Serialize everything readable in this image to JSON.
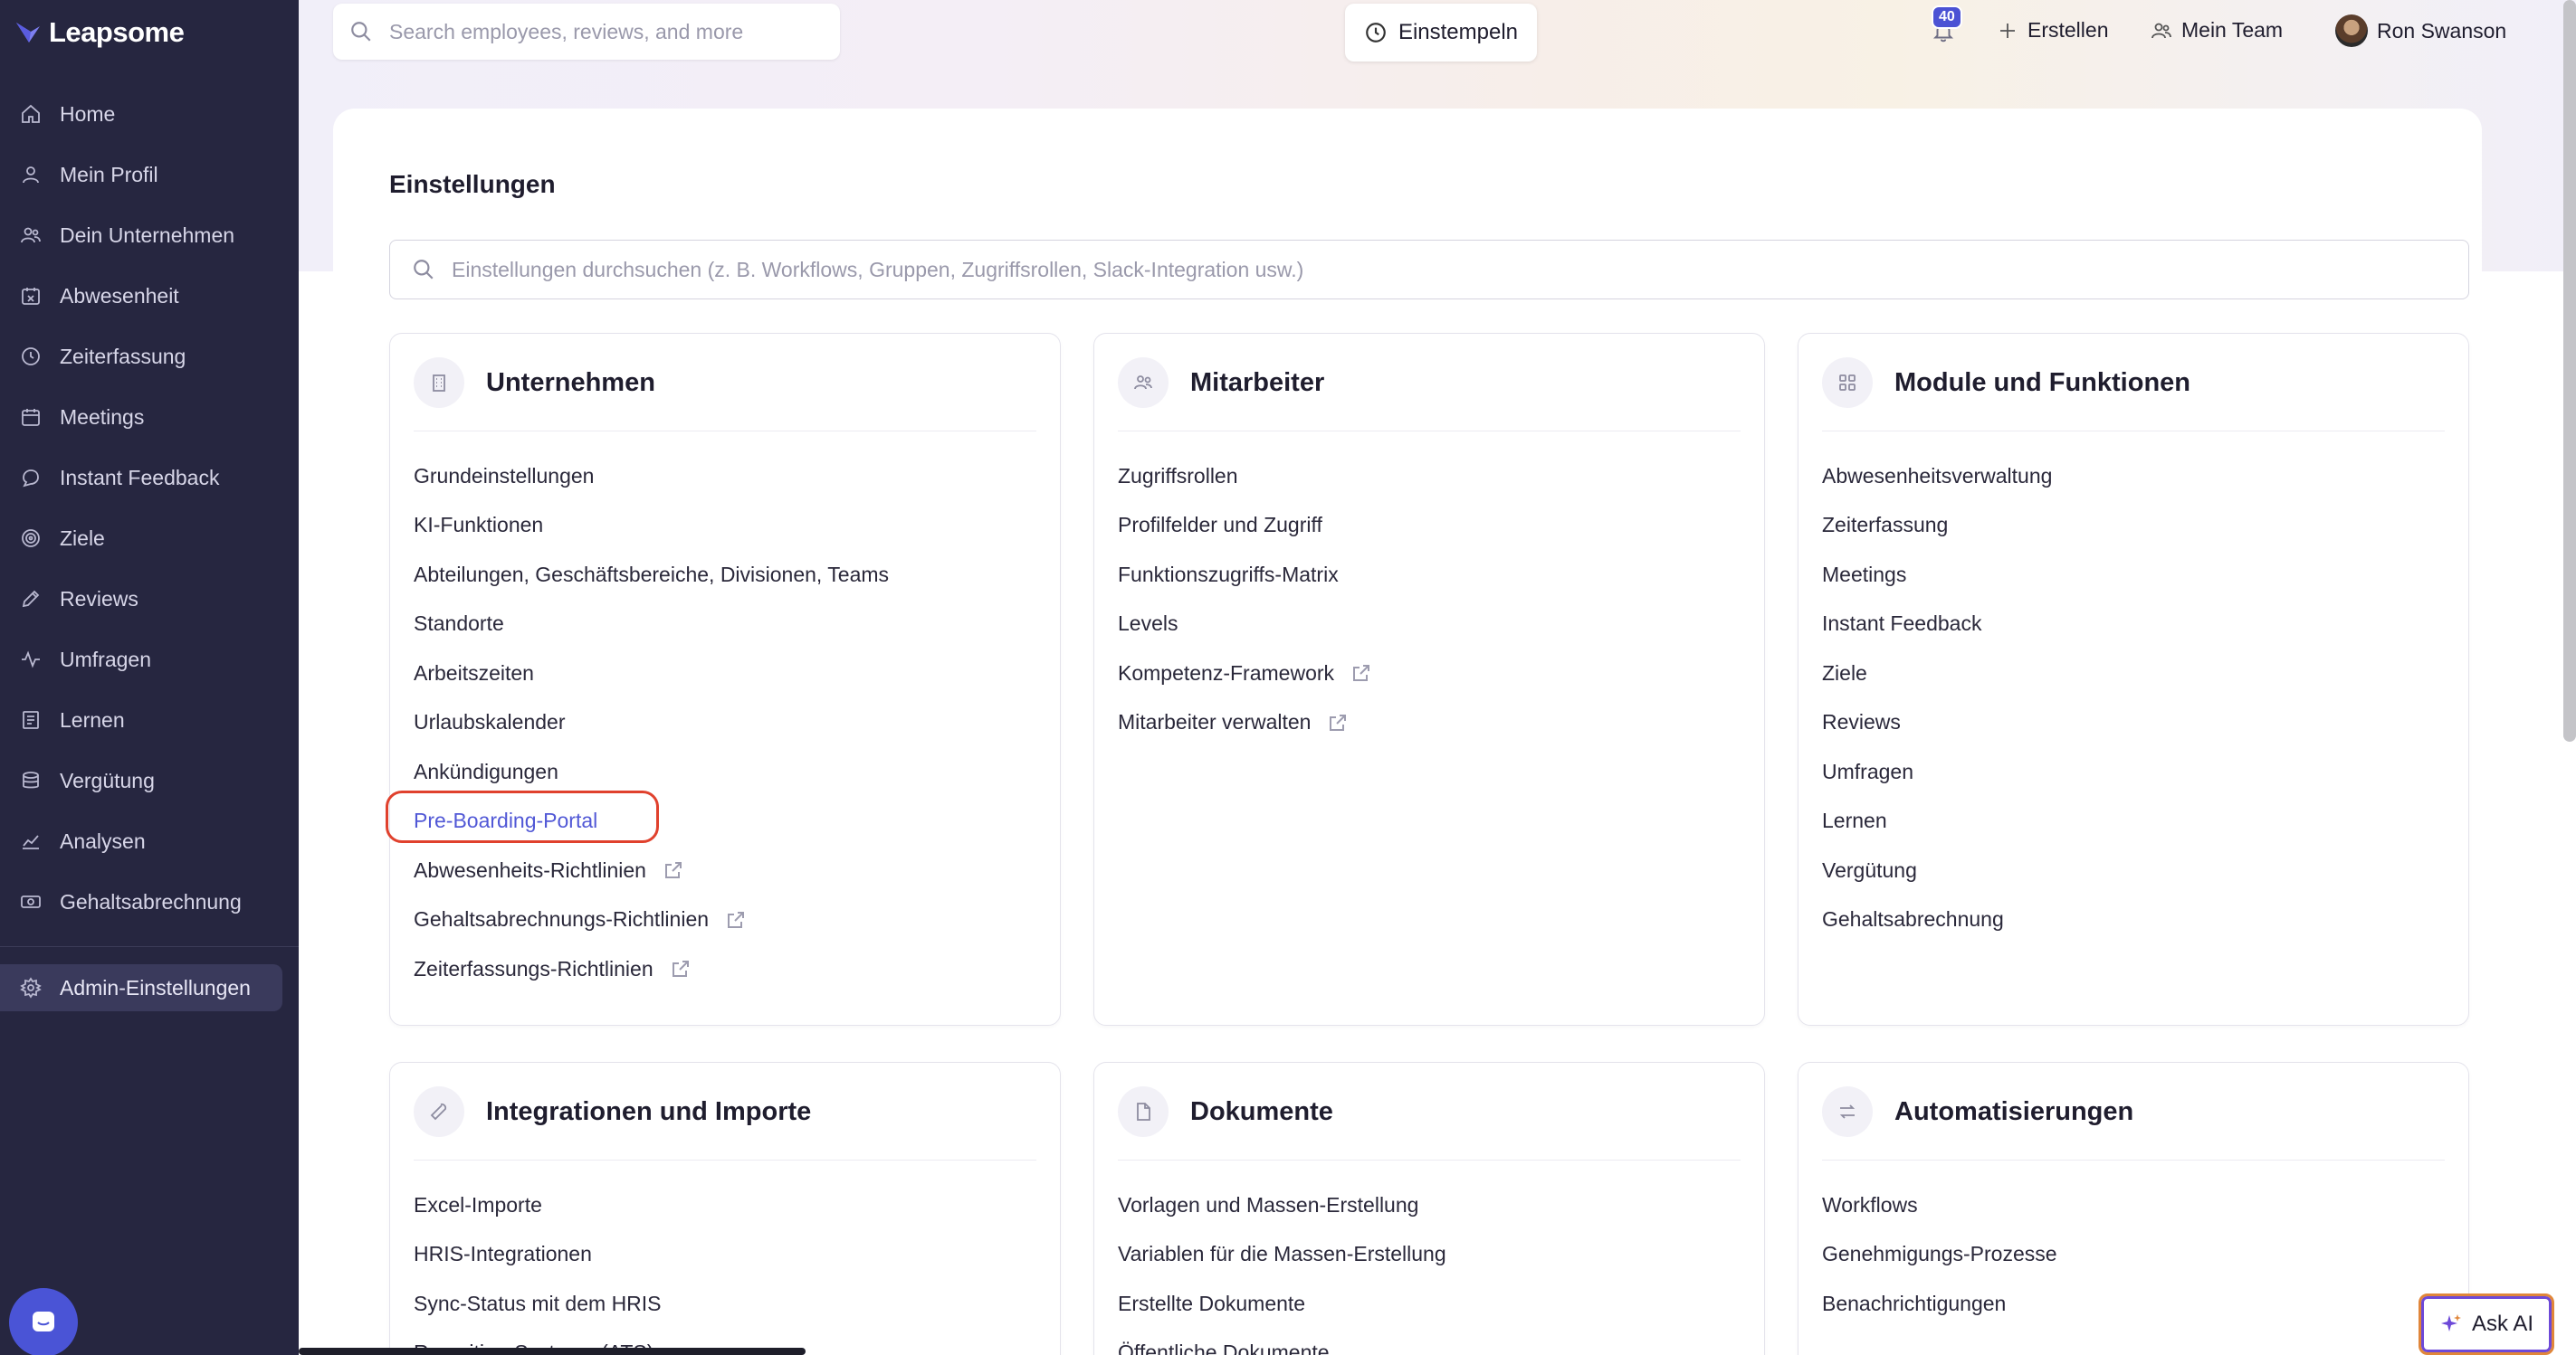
{
  "app": {
    "name": "Leapsome"
  },
  "sidebar": {
    "items": [
      {
        "label": "Home",
        "icon": "home-icon"
      },
      {
        "label": "Mein Profil",
        "icon": "user-icon"
      },
      {
        "label": "Dein Unternehmen",
        "icon": "users-icon"
      },
      {
        "label": "Abwesenheit",
        "icon": "calendar-x-icon"
      },
      {
        "label": "Zeiterfassung",
        "icon": "clock-icon"
      },
      {
        "label": "Meetings",
        "icon": "calendar-icon"
      },
      {
        "label": "Instant Feedback",
        "icon": "chat-icon"
      },
      {
        "label": "Ziele",
        "icon": "target-icon"
      },
      {
        "label": "Reviews",
        "icon": "pen-icon"
      },
      {
        "label": "Umfragen",
        "icon": "pulse-icon"
      },
      {
        "label": "Lernen",
        "icon": "book-icon"
      },
      {
        "label": "Vergütung",
        "icon": "coins-icon"
      },
      {
        "label": "Analysen",
        "icon": "chart-icon"
      },
      {
        "label": "Gehaltsabrechnung",
        "icon": "money-icon"
      }
    ],
    "admin": {
      "label": "Admin-Einstellungen",
      "icon": "gear-icon"
    }
  },
  "topbar": {
    "search_placeholder": "Search employees, reviews, and more",
    "clock_label": "Einstempeln",
    "notification_count": "40",
    "create_label": "Erstellen",
    "team_label": "Mein Team",
    "user_name": "Ron Swanson"
  },
  "page": {
    "title": "Einstellungen",
    "search_placeholder": "Einstellungen durchsuchen (z. B. Workflows, Gruppen, Zugriffsrollen, Slack-Integration usw.)"
  },
  "cards": {
    "unternehmen": {
      "title": "Unternehmen",
      "links": [
        "Grundeinstellungen",
        "KI-Funktionen",
        "Abteilungen, Geschäftsbereiche, Divisionen, Teams",
        "Standorte",
        "Arbeitszeiten",
        "Urlaubskalender",
        "Ankündigungen",
        "Pre-Boarding-Portal",
        "Abwesenheits-Richtlinien",
        "Gehaltsabrechnungs-Richtlinien",
        "Zeiterfassungs-Richtlinien"
      ]
    },
    "mitarbeiter": {
      "title": "Mitarbeiter",
      "links": [
        "Zugriffsrollen",
        "Profilfelder und Zugriff",
        "Funktionszugriffs-Matrix",
        "Levels",
        "Kompetenz-Framework",
        "Mitarbeiter verwalten"
      ]
    },
    "module": {
      "title": "Module und Funktionen",
      "links": [
        "Abwesenheitsverwaltung",
        "Zeiterfassung",
        "Meetings",
        "Instant Feedback",
        "Ziele",
        "Reviews",
        "Umfragen",
        "Lernen",
        "Vergütung",
        "Gehaltsabrechnung"
      ]
    },
    "integrationen": {
      "title": "Integrationen und Importe",
      "links": [
        "Excel-Importe",
        "HRIS-Integrationen",
        "Sync-Status mit dem HRIS",
        "Recruiting-Systeme (ATS)"
      ]
    },
    "dokumente": {
      "title": "Dokumente",
      "links": [
        "Vorlagen und Massen-Erstellung",
        "Variablen für die Massen-Erstellung",
        "Erstellte Dokumente",
        "Öffentliche Dokumente"
      ]
    },
    "automatisierungen": {
      "title": "Automatisierungen",
      "links": [
        "Workflows",
        "Genehmigungs-Prozesse",
        "Benachrichtigungen"
      ]
    }
  },
  "ask_ai": {
    "label": "Ask AI"
  },
  "colors": {
    "sidebar": "#262640",
    "accent": "#4b52d4",
    "highlight": "#e0412d"
  }
}
